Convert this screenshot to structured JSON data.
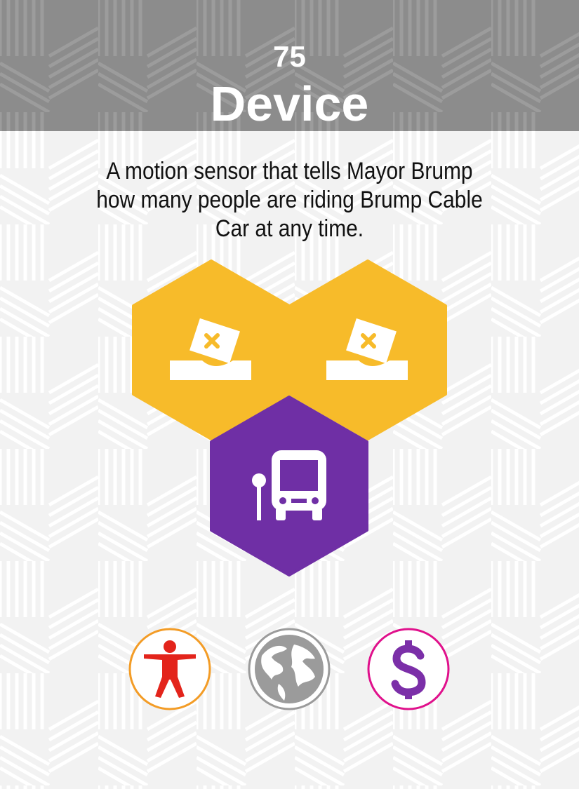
{
  "card": {
    "number": "75",
    "title": "Device",
    "description": "A motion sensor that tells Mayor Brump how many people are riding Brump Cable Car at any time."
  },
  "tiles": [
    {
      "icon": "ballot-box-icon",
      "color": "#f7bb2a"
    },
    {
      "icon": "ballot-box-icon",
      "color": "#f7bb2a"
    },
    {
      "icon": "bus-stop-icon",
      "color": "#6f2fa5"
    }
  ],
  "stats": [
    {
      "icon": "person-icon",
      "color": "#e3241b",
      "ring": "#f39c26"
    },
    {
      "icon": "globe-icon",
      "color": "#9b9b9b",
      "ring": "#9b9b9b"
    },
    {
      "icon": "dollar-icon",
      "color": "#7b2fa8",
      "ring": "#e0118c"
    }
  ],
  "colors": {
    "header": "#8c8c8c",
    "background": "#f2f2f2"
  }
}
